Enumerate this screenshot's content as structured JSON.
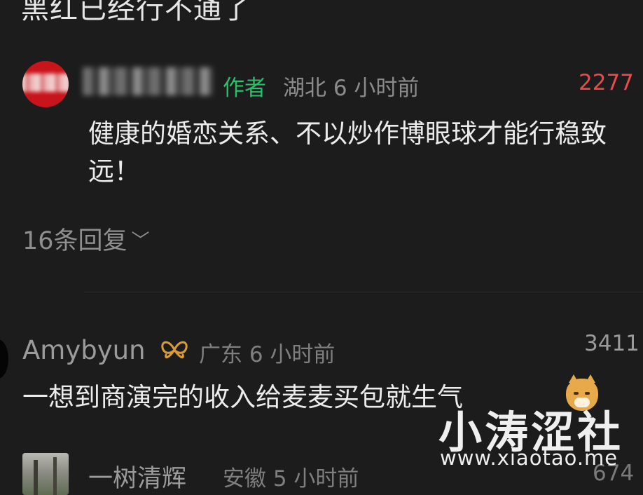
{
  "top_text": "黑红已经行不通了",
  "comments": [
    {
      "author_tag": "作者",
      "location": "湖北",
      "time": "6 小时前",
      "likes": "2277",
      "body": "健康的婚恋关系、不以炒作博眼球才能行稳致远！",
      "replies_label": "16条回复"
    },
    {
      "username": "Amybyun",
      "location": "广东",
      "time": "6 小时前",
      "likes": "3411",
      "body": "一想到商演完的收入给麦麦买包就生气"
    },
    {
      "username": "一树清辉",
      "location": "安徽",
      "time": "5 小时前",
      "likes": "674"
    }
  ],
  "watermark": {
    "title": "小涛涩社",
    "url": "www.xiaotao.me"
  },
  "colors": {
    "background": "#1c1c1c",
    "author_tag": "#27c06c",
    "highlight_likes": "#ea4a4a"
  },
  "icons": {
    "replies_expand": "chevron-down-icon",
    "badge": "butterfly-badge-icon",
    "emoji": "doge-emoji-icon"
  }
}
